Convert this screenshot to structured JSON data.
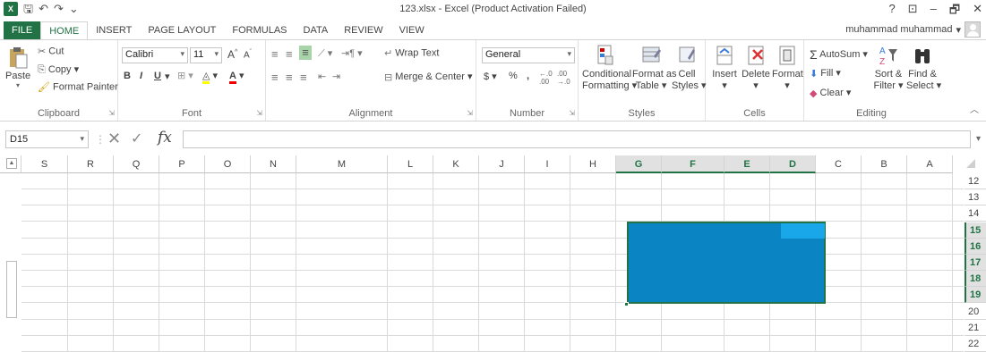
{
  "window": {
    "title": "123.xlsx - Excel (Product Activation Failed)",
    "controls": [
      "?",
      "⊡",
      "–",
      "🗗",
      "✕"
    ]
  },
  "tabs": [
    "FILE",
    "HOME",
    "INSERT",
    "PAGE LAYOUT",
    "FORMULAS",
    "DATA",
    "REVIEW",
    "VIEW"
  ],
  "active_tab": "HOME",
  "user": {
    "name": "muhammad muhammad"
  },
  "ribbon": {
    "clipboard": {
      "label": "Clipboard",
      "paste": "Paste",
      "cut": "Cut",
      "copy": "Copy",
      "format_painter": "Format Painter"
    },
    "font": {
      "label": "Font",
      "name": "Calibri",
      "size": "11",
      "bold": "B",
      "italic": "I",
      "underline": "U"
    },
    "alignment": {
      "label": "Alignment",
      "wrap_text": "Wrap Text",
      "merge_center": "Merge & Center"
    },
    "number": {
      "label": "Number",
      "format": "General",
      "currency": "$",
      "percent": "%",
      "comma": ","
    },
    "styles": {
      "label": "Styles",
      "conditional": "Conditional",
      "formatting": "Formatting",
      "format_as": "Format as",
      "table": "Table",
      "cell": "Cell",
      "styles": "Styles"
    },
    "cells": {
      "label": "Cells",
      "insert": "Insert",
      "delete": "Delete",
      "format": "Format"
    },
    "editing": {
      "label": "Editing",
      "autosum": "AutoSum",
      "fill": "Fill",
      "clear": "Clear",
      "sort": "Sort &",
      "filter": "Filter",
      "find": "Find &",
      "select": "Select"
    }
  },
  "formula_bar": {
    "name_box": "D15",
    "fx": "fx",
    "formula": ""
  },
  "columns": [
    {
      "label": "S"
    },
    {
      "label": "R"
    },
    {
      "label": "Q"
    },
    {
      "label": "P"
    },
    {
      "label": "O"
    },
    {
      "label": "N"
    },
    {
      "label": "M"
    },
    {
      "label": "L"
    },
    {
      "label": "K"
    },
    {
      "label": "J"
    },
    {
      "label": "I"
    },
    {
      "label": "H"
    },
    {
      "label": "G",
      "selected": true
    },
    {
      "label": "F",
      "selected": true
    },
    {
      "label": "E",
      "selected": true
    },
    {
      "label": "D",
      "selected": true
    },
    {
      "label": "C"
    },
    {
      "label": "B"
    },
    {
      "label": "A"
    }
  ],
  "rows": [
    {
      "label": "12"
    },
    {
      "label": "13"
    },
    {
      "label": "14"
    },
    {
      "label": "15",
      "selected": true
    },
    {
      "label": "16",
      "selected": true
    },
    {
      "label": "17",
      "selected": true
    },
    {
      "label": "18",
      "selected": true
    },
    {
      "label": "19",
      "selected": true
    },
    {
      "label": "20"
    },
    {
      "label": "21"
    },
    {
      "label": "22"
    }
  ],
  "colors": {
    "accent": "#217346",
    "selection": "#0a84c2",
    "active_cell": "#1aa7ea"
  }
}
